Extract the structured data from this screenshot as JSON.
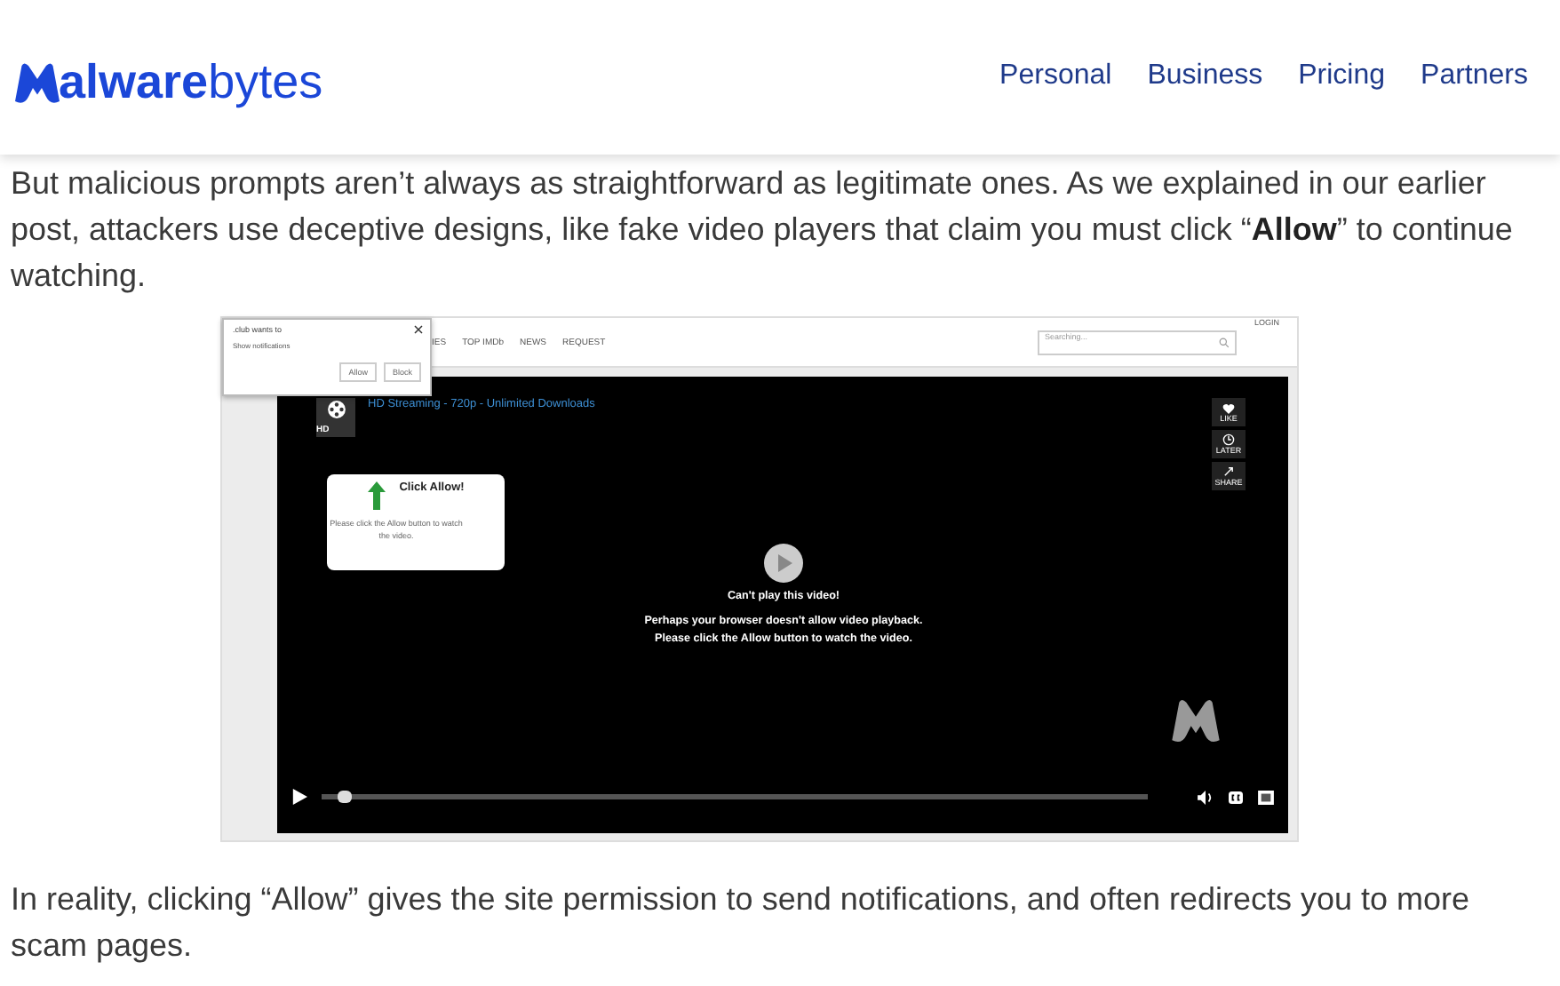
{
  "header": {
    "logo": {
      "bold": "alware",
      "light": "bytes"
    },
    "nav": [
      "Personal",
      "Business",
      "Pricing",
      "Partners"
    ]
  },
  "paragraphs": [
    "But malicious prompts aren’t always as straightforward as legitimate ones. As we explained in our earlier post, attackers use deceptive designs, like fake video players that claim you must click “**Allow**” to continue watching.",
    "In reality, clicking “Allow” gives the site permission to send notifications, and often redirects you to more scam pages."
  ],
  "screenshot": {
    "site_nav": [
      "IES",
      "TOP IMDb",
      "NEWS",
      "REQUEST"
    ],
    "search": {
      "placeholder": "Searching..."
    },
    "login": "LOGIN",
    "popup": {
      "origin": ".club wants to",
      "permission": "Show notifications",
      "buttons": [
        "Allow",
        "Block"
      ]
    },
    "video": {
      "badge": "HD",
      "title": "HD Streaming - 720p - Unlimited Downloads",
      "side_actions": [
        {
          "kind": "like",
          "label": "LIKE"
        },
        {
          "kind": "later",
          "label": "LATER"
        },
        {
          "kind": "share",
          "label": "SHARE"
        }
      ],
      "prompt": {
        "heading": "Click Allow!",
        "text": "Please click the Allow button to watch the video."
      },
      "message": [
        "Can't play this video!",
        "Perhaps your browser doesn't allow video playback. Please click the Allow button to watch the video."
      ],
      "progress": {
        "level": 0.02
      }
    }
  }
}
